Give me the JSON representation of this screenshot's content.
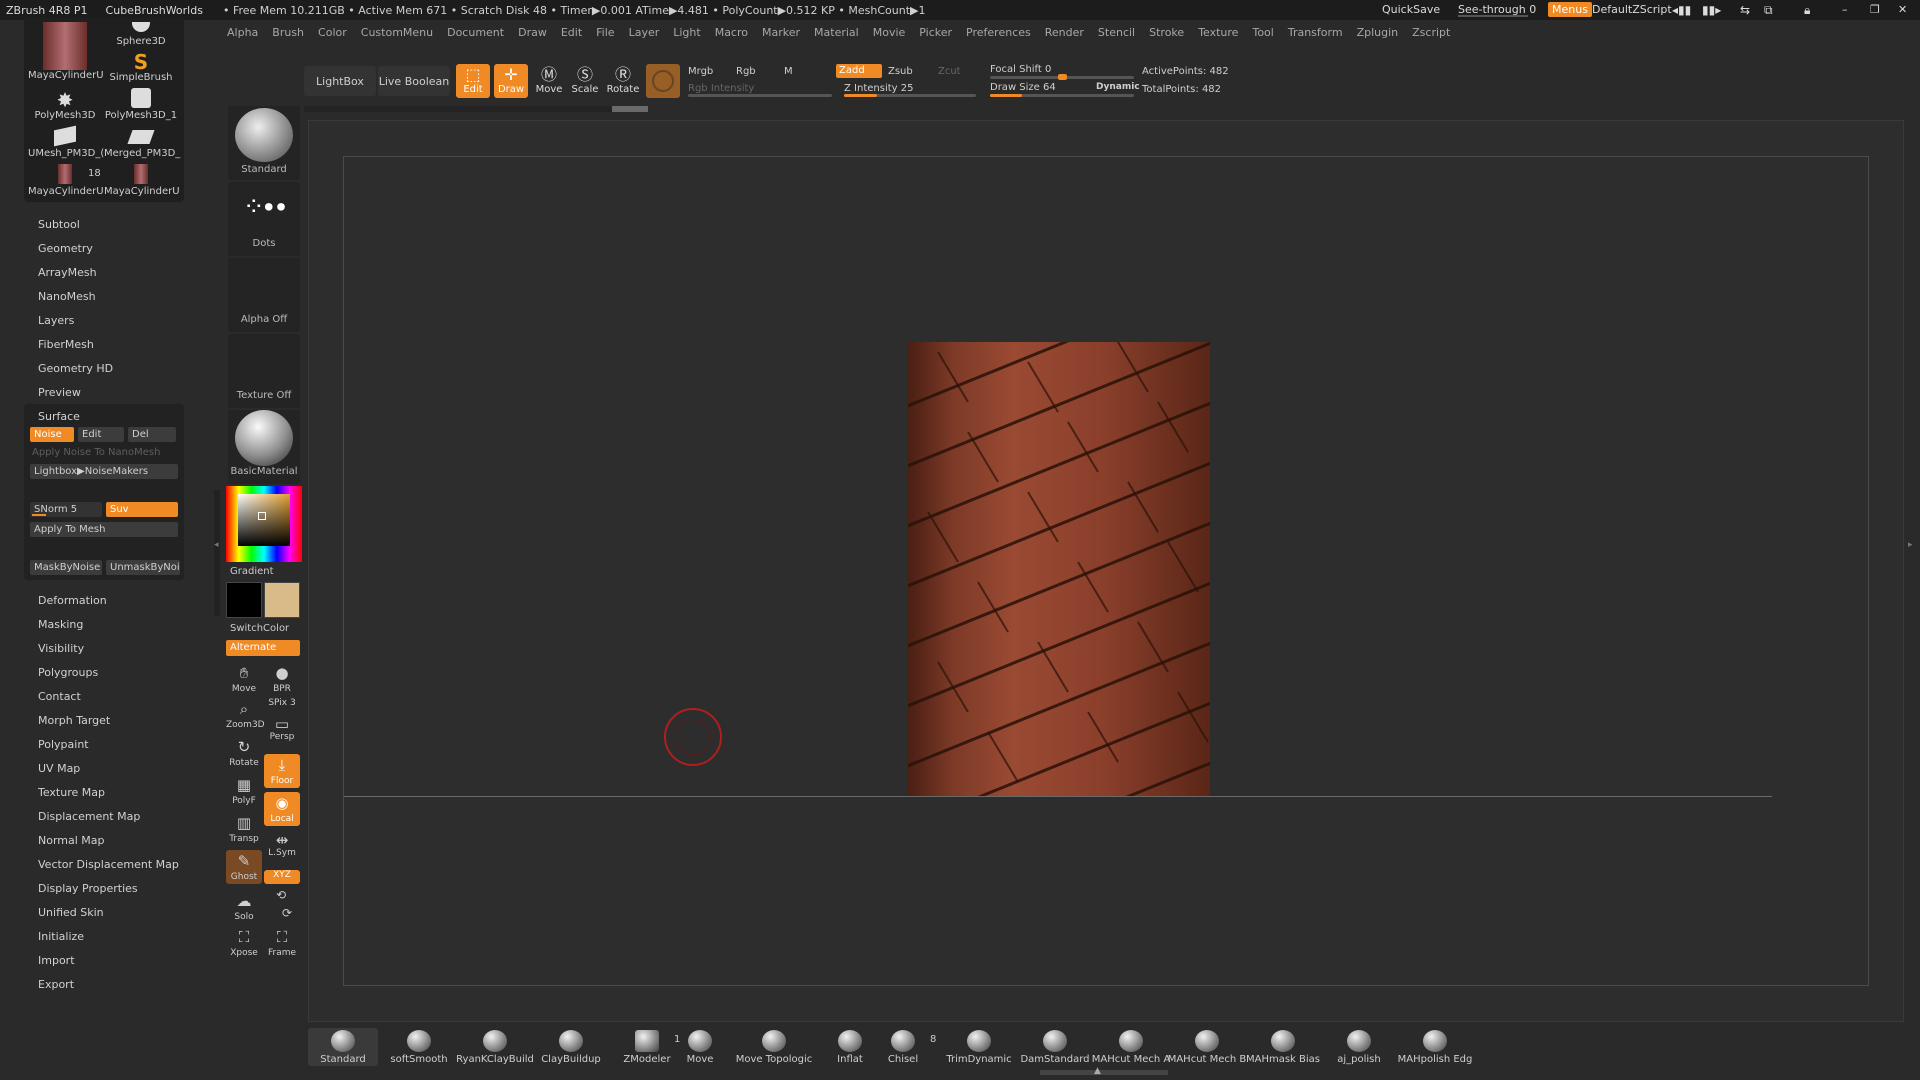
{
  "titlebar": {
    "app": "ZBrush 4R8 P1",
    "project": "CubeBrushWorlds",
    "stats": "• Free Mem 10.211GB • Active Mem 671 • Scratch Disk 48 • Timer▶0.001 ATime▶4.481 • PolyCount▶0.512 KP • MeshCount▶1",
    "quicksave": "QuickSave",
    "see_through": "See-through  0",
    "menus": "Menus",
    "script": "DefaultZScript"
  },
  "menus": [
    "Alpha",
    "Brush",
    "Color",
    "CustomMenu",
    "Document",
    "Draw",
    "Edit",
    "File",
    "Layer",
    "Light",
    "Macro",
    "Marker",
    "Material",
    "Movie",
    "Picker",
    "Preferences",
    "Render",
    "Stencil",
    "Stroke",
    "Texture",
    "Tool",
    "Transform",
    "Zplugin",
    "Zscript"
  ],
  "shelf": {
    "lightbox": "LightBox",
    "live_boolean": "Live Boolean",
    "edit": "Edit",
    "draw": "Draw",
    "move": "Move",
    "scale": "Scale",
    "rotate": "Rotate",
    "mrgb": "Mrgb",
    "rgb": "Rgb",
    "m": "M",
    "rgb_intensity": "Rgb Intensity",
    "zadd": "Zadd",
    "zsub": "Zsub",
    "zcut": "Zcut",
    "z_intensity": "Z Intensity 25",
    "z_intensity_value": 25,
    "focal_shift": "Focal Shift 0",
    "focal_shift_value": 0,
    "draw_size": "Draw Size 64",
    "draw_size_value": 64,
    "dynamic": "Dynamic",
    "active_points": "ActivePoints: 482",
    "total_points": "TotalPoints: 482"
  },
  "subtools": [
    {
      "label": "MayaCylinderU"
    },
    {
      "label": "Sphere3D"
    },
    {
      "label": "SimpleBrush"
    },
    {
      "label": "PolyMesh3D"
    },
    {
      "label": "PolyMesh3D_1"
    },
    {
      "label": "UMesh_PM3D_("
    },
    {
      "label": "Merged_PM3D_"
    },
    {
      "label": "MayaCylinderU"
    },
    {
      "label": "MayaCylinderU"
    }
  ],
  "subtool_count": "18",
  "tool_menu": [
    "Subtool",
    "Geometry",
    "ArrayMesh",
    "NanoMesh",
    "Layers",
    "FiberMesh",
    "Geometry HD",
    "Preview"
  ],
  "surface": {
    "title": "Surface",
    "noise": "Noise",
    "edit": "Edit",
    "del": "Del",
    "apply_nano": "Apply Noise To NanoMesh",
    "noisemakers": "Lightbox▶NoiseMakers",
    "snorm": "SNorm 5",
    "suv": "Suv",
    "apply_mesh": "Apply To Mesh",
    "maskbynoise": "MaskByNoise",
    "unmaskbynoise": "UnmaskByNoi"
  },
  "tool_menu2": [
    "Deformation",
    "Masking",
    "Visibility",
    "Polygroups",
    "Contact",
    "Morph Target",
    "Polypaint",
    "UV Map",
    "Texture Map",
    "Displacement Map",
    "Normal Map",
    "Vector Displacement Map",
    "Display Properties",
    "Unified Skin",
    "Initialize",
    "Import",
    "Export"
  ],
  "leftcol": {
    "brush": "Standard",
    "stroke": "Dots",
    "alpha": "Alpha Off",
    "texture": "Texture Off",
    "material": "BasicMaterial",
    "gradient": "Gradient",
    "switchcolor": "SwitchColor",
    "alternate": "Alternate"
  },
  "nav_buttons": [
    {
      "label": "Move"
    },
    {
      "label": "BPR"
    },
    {
      "label": "Zoom3D"
    },
    {
      "label": "SPix 3"
    },
    {
      "label": "Persp"
    },
    {
      "label": "Rotate"
    },
    {
      "label": "Floor"
    },
    {
      "label": "PolyF"
    },
    {
      "label": "Local"
    },
    {
      "label": "Transp"
    },
    {
      "label": "L.Sym"
    },
    {
      "label": "Ghost"
    },
    {
      "label": "XYZ"
    },
    {
      "label": "Solo"
    },
    {
      "label": "Xpose"
    },
    {
      "label": "Frame"
    }
  ],
  "brushes": [
    {
      "label": "Standard"
    },
    {
      "label": "softSmooth"
    },
    {
      "label": "RyanKClayBuild"
    },
    {
      "label": "ClayBuildup"
    },
    {
      "label": "ZModeler"
    },
    {
      "label": "Move"
    },
    {
      "label": "Move Topologic"
    },
    {
      "label": "Inflat"
    },
    {
      "label": "Chisel"
    },
    {
      "label": "TrimDynamic"
    },
    {
      "label": "DamStandard"
    },
    {
      "label": "MAHcut Mech A"
    },
    {
      "label": "MAHcut Mech B"
    },
    {
      "label": "MAHmask Bias"
    },
    {
      "label": "aj_polish"
    },
    {
      "label": "MAHpolish Edg"
    }
  ],
  "brush_counts": {
    "zmodeler": "1",
    "chisel": "8"
  },
  "colors": {
    "accent": "#f08a24",
    "bg": "#2a2a2a",
    "canvas": "#2d2d2d",
    "brick": "#8b3e2b"
  }
}
